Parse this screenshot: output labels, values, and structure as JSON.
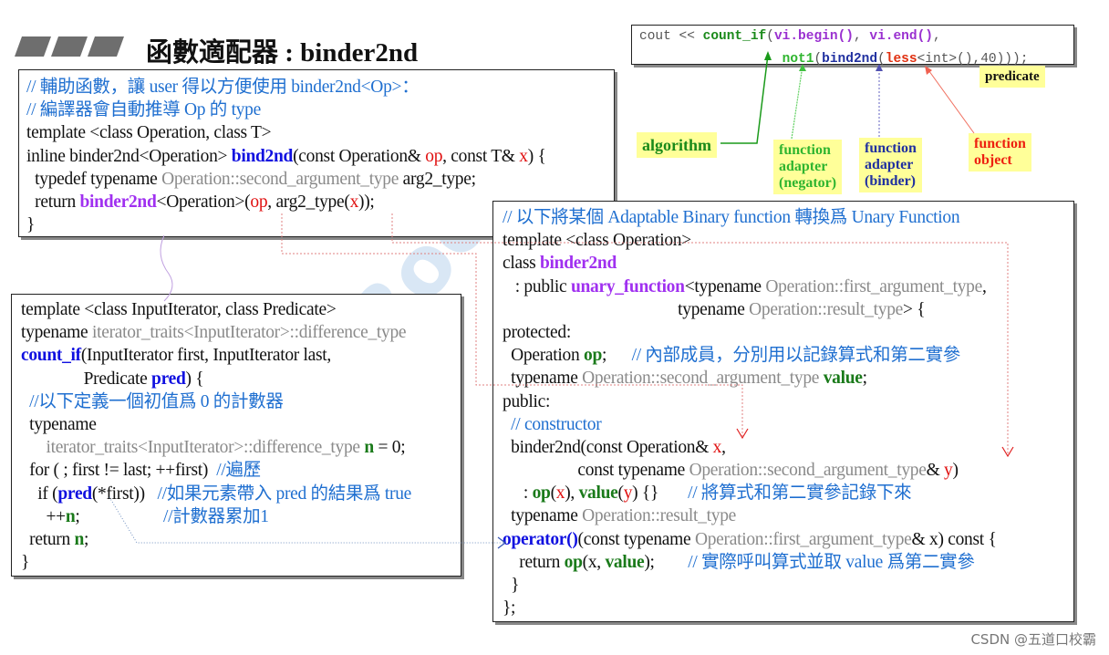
{
  "slide": {
    "title": "函數適配器 : binder2nd",
    "watermark": "Boolan",
    "footer": "CSDN @五道口校霸"
  },
  "colors": {
    "comment": "#1f6fd0",
    "type_gray": "#8a8a8a",
    "purple": "#a030f0",
    "blue": "#1010e0",
    "red": "#e01010",
    "green": "#1a7a1a",
    "label_bg": "#ffff99"
  },
  "snippet": {
    "lines": [
      [
        [
          "cout << ",
          "m-k"
        ],
        [
          "count_if",
          "m-g"
        ],
        [
          "(",
          "m-k"
        ],
        [
          "vi.begin()",
          "m-p"
        ],
        [
          ", ",
          "m-k"
        ],
        [
          "vi.end()",
          "m-p"
        ],
        [
          ",",
          "m-k"
        ]
      ],
      [
        [
          "                  ",
          ""
        ],
        [
          "not1",
          "m-n"
        ],
        [
          "(",
          "m-k"
        ],
        [
          "bind2nd",
          "m-b"
        ],
        [
          "(",
          "m-k"
        ],
        [
          "less",
          "m-r"
        ],
        [
          "<int>(),40)));",
          "m-k"
        ]
      ]
    ]
  },
  "labels": {
    "predicate": "predicate",
    "algorithm": "algorithm",
    "negator": [
      "function",
      "adapter",
      "(negator)"
    ],
    "binder": [
      "function",
      "adapter",
      "(binder)"
    ],
    "function_object": [
      "function",
      "object"
    ]
  },
  "bind2nd_box": {
    "lines": [
      [
        [
          "// 輔助函數，讓 user 得以方便使用 binder2nd<Op>：",
          "c"
        ]
      ],
      [
        [
          "// 編譯器會自動推導 Op 的 type",
          "c"
        ]
      ],
      [
        [
          "template <class Operation, class T>",
          ""
        ]
      ],
      [
        [
          "inline binder2nd<Operation> ",
          ""
        ],
        [
          "bind2nd",
          "b"
        ],
        [
          "(const Operation& ",
          ""
        ],
        [
          "op",
          "r"
        ],
        [
          ", const T& ",
          ""
        ],
        [
          "x",
          "r"
        ],
        [
          ") {",
          ""
        ]
      ],
      [
        [
          "  typedef typename ",
          ""
        ],
        [
          "Operation::second_argument_type",
          "g"
        ],
        [
          " arg2_type;",
          ""
        ]
      ],
      [
        [
          "  return ",
          ""
        ],
        [
          "binder2nd",
          "p"
        ],
        [
          "<Operation>(",
          ""
        ],
        [
          "op",
          "r"
        ],
        [
          ", arg2_type(",
          ""
        ],
        [
          "x",
          "r"
        ],
        [
          "));",
          ""
        ]
      ],
      [
        [
          "}",
          ""
        ]
      ]
    ]
  },
  "count_if_box": {
    "lines": [
      [
        [
          "template <class InputIterator, class Predicate>",
          ""
        ]
      ],
      [
        [
          "typename ",
          ""
        ],
        [
          "iterator_traits<InputIterator>::difference_type",
          "g"
        ]
      ],
      [
        [
          "count_if",
          "b"
        ],
        [
          "(InputIterator first, InputIterator last,",
          ""
        ]
      ],
      [
        [
          "               Predicate ",
          ""
        ],
        [
          "pred",
          "b"
        ],
        [
          ") {",
          ""
        ]
      ],
      [
        [
          "  //以下定義一個初值爲 0 的計數器",
          "c"
        ]
      ],
      [
        [
          "  typename",
          ""
        ]
      ],
      [
        [
          "      ",
          ""
        ],
        [
          "iterator_traits<InputIterator>::difference_type",
          "g"
        ],
        [
          " ",
          ""
        ],
        [
          "n",
          "G"
        ],
        [
          " = 0;",
          ""
        ]
      ],
      [
        [
          "  for ( ; first != last; ++first)  ",
          ""
        ],
        [
          "//遍歷",
          "c"
        ]
      ],
      [
        [
          "    if (",
          ""
        ],
        [
          "pred",
          "b"
        ],
        [
          "(*first))   ",
          ""
        ],
        [
          "//如果元素帶入 pred 的結果爲 true",
          "c"
        ]
      ],
      [
        [
          "      ++",
          ""
        ],
        [
          "n",
          "G"
        ],
        [
          ";                    ",
          ""
        ],
        [
          "//計數器累加1",
          "c"
        ]
      ],
      [
        [
          "  return ",
          ""
        ],
        [
          "n",
          "G"
        ],
        [
          ";",
          ""
        ]
      ],
      [
        [
          "}",
          ""
        ]
      ]
    ]
  },
  "binder2nd_box": {
    "lines": [
      [
        [
          "// 以下將某個 Adaptable Binary function 轉換爲 Unary Function",
          "c"
        ]
      ],
      [
        [
          "template <class Operation>",
          ""
        ]
      ],
      [
        [
          "class ",
          ""
        ],
        [
          "binder2nd",
          "p"
        ]
      ],
      [
        [
          "   : public ",
          ""
        ],
        [
          "unary_function",
          "p"
        ],
        [
          "<typename ",
          ""
        ],
        [
          "Operation::first_argument_type",
          "g"
        ],
        [
          ",",
          ""
        ]
      ],
      [
        [
          "                                          typename ",
          ""
        ],
        [
          "Operation::result_type",
          "g"
        ],
        [
          "> {",
          ""
        ]
      ],
      [
        [
          "protected:",
          ""
        ]
      ],
      [
        [
          "  Operation ",
          ""
        ],
        [
          "op",
          "G"
        ],
        [
          ";      ",
          ""
        ],
        [
          "// 內部成員，分別用以記錄算式和第二實參",
          "c"
        ]
      ],
      [
        [
          "  typename ",
          ""
        ],
        [
          "Operation::second_argument_type",
          "g"
        ],
        [
          " ",
          ""
        ],
        [
          "value",
          "G"
        ],
        [
          ";",
          ""
        ]
      ],
      [
        [
          "public:",
          ""
        ]
      ],
      [
        [
          "  // constructor",
          "c"
        ]
      ],
      [
        [
          "  binder2nd(const Operation& ",
          ""
        ],
        [
          "x",
          "r"
        ],
        [
          ",",
          ""
        ]
      ],
      [
        [
          "                  const typename ",
          ""
        ],
        [
          "Operation::second_argument_type",
          "g"
        ],
        [
          "& ",
          ""
        ],
        [
          "y",
          "r"
        ],
        [
          ")",
          ""
        ]
      ],
      [
        [
          "     : ",
          ""
        ],
        [
          "op",
          "G"
        ],
        [
          "(",
          ""
        ],
        [
          "x",
          "r"
        ],
        [
          "), ",
          ""
        ],
        [
          "value",
          "G"
        ],
        [
          "(",
          ""
        ],
        [
          "y",
          "r"
        ],
        [
          ") {}       ",
          ""
        ],
        [
          "// 將算式和第二實參記錄下來",
          "c"
        ]
      ],
      [
        [
          "  typename ",
          ""
        ],
        [
          "Operation::result_type",
          "g"
        ]
      ],
      [
        [
          "",
          ""
        ],
        [
          "operator()",
          "b"
        ],
        [
          "(const typename ",
          ""
        ],
        [
          "Operation::first_argument_type",
          "g"
        ],
        [
          "& x) const {",
          ""
        ]
      ],
      [
        [
          "    return ",
          ""
        ],
        [
          "op",
          "G"
        ],
        [
          "(x, ",
          ""
        ],
        [
          "value",
          "G"
        ],
        [
          ");        ",
          ""
        ],
        [
          "// 實際呼叫算式並取 value 爲第二實參",
          "c"
        ]
      ],
      [
        [
          "  }",
          ""
        ]
      ],
      [
        [
          "};",
          ""
        ]
      ]
    ]
  }
}
